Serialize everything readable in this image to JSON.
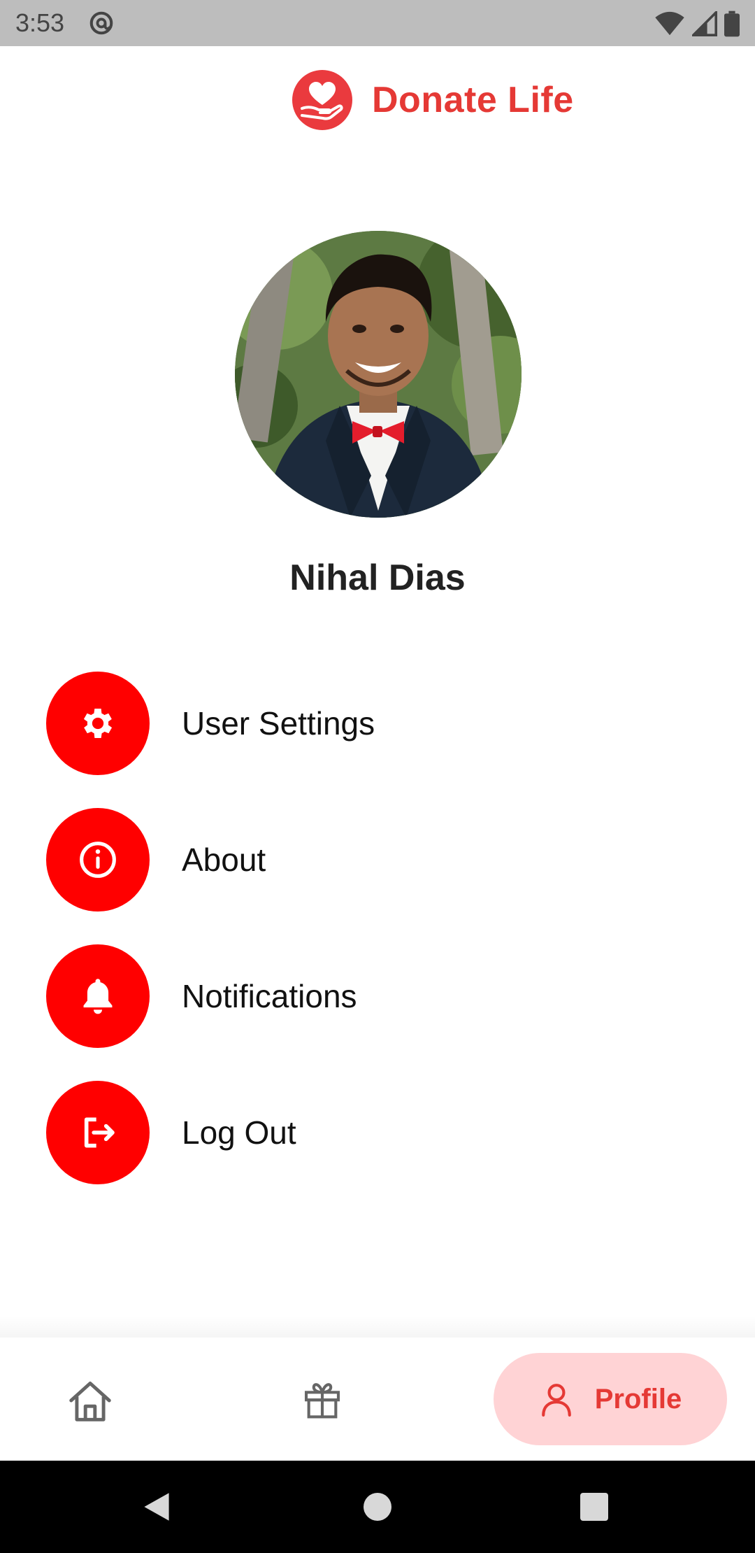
{
  "status_bar": {
    "time": "3:53",
    "icons": [
      "sync-icon",
      "wifi-icon",
      "cell-signal-icon",
      "battery-icon"
    ]
  },
  "header": {
    "title": "Donate Life",
    "logo_icon": "heart-hand-icon",
    "accent_color": "#e53935"
  },
  "profile": {
    "name": "Nihal Dias"
  },
  "menu": {
    "items": [
      {
        "label": "User Settings",
        "icon": "gear-icon"
      },
      {
        "label": "About",
        "icon": "info-icon"
      },
      {
        "label": "Notifications",
        "icon": "bell-icon"
      },
      {
        "label": "Log Out",
        "icon": "logout-icon"
      }
    ],
    "icon_bg_color": "#ff0000"
  },
  "bottom_nav": {
    "items": [
      {
        "icon": "home-icon",
        "active": false
      },
      {
        "icon": "gift-icon",
        "active": false
      },
      {
        "icon": "user-icon",
        "label": "Profile",
        "active": true
      }
    ],
    "active_bg_color": "#ffd3d5"
  },
  "system_nav": {
    "buttons": [
      "back-icon",
      "home-circle-icon",
      "recents-icon"
    ]
  }
}
